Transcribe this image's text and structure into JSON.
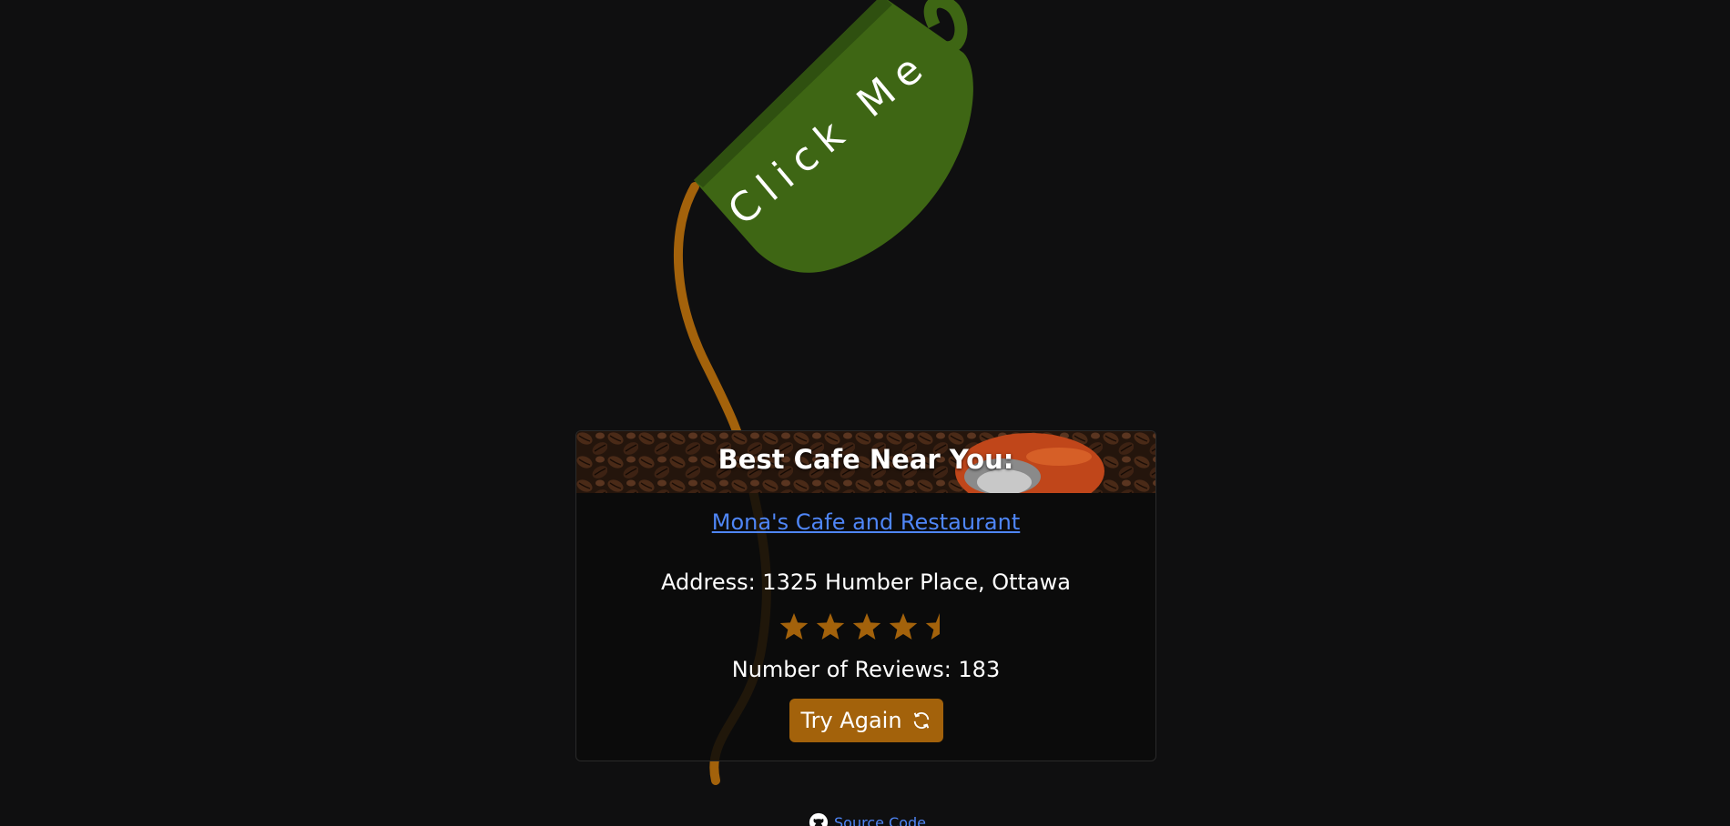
{
  "cup": {
    "label": "Click Me",
    "color": "#3e6614"
  },
  "pour_color": "#a3620b",
  "card": {
    "title": "Best Cafe Near You:",
    "cafe_name": "Mona's Cafe and Restaurant",
    "address": "Address: 1325 Humber Place, Ottawa",
    "rating": 4.5,
    "rating_max": 5,
    "reviews": "Number of Reviews: 183",
    "try_again_label": "Try Again",
    "try_again_icon": "refresh-icon"
  },
  "footer": {
    "source_label": "Source Code",
    "source_icon": "github-icon"
  }
}
